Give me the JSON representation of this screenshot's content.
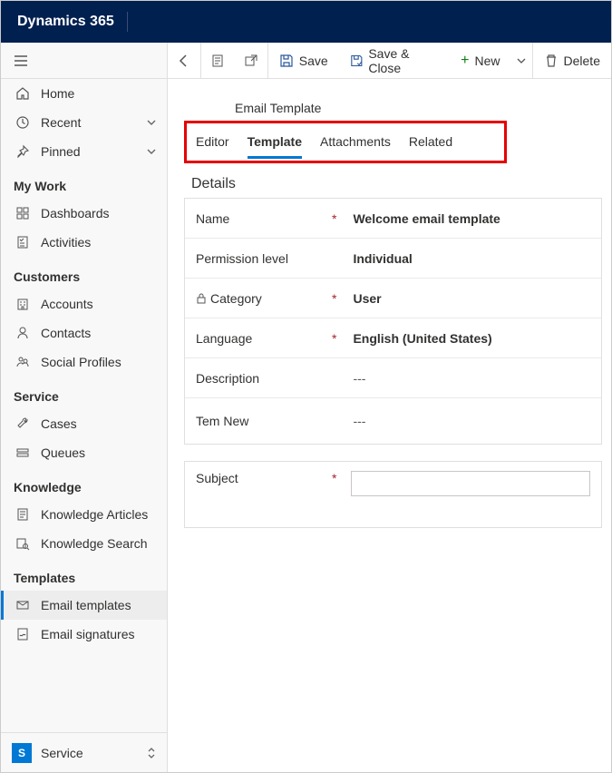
{
  "header": {
    "app_name": "Dynamics 365"
  },
  "sidebar": {
    "top": [
      {
        "icon": "home",
        "label": "Home"
      },
      {
        "icon": "clock",
        "label": "Recent",
        "expand": true
      },
      {
        "icon": "pin",
        "label": "Pinned",
        "expand": true
      }
    ],
    "sections": [
      {
        "title": "My Work",
        "items": [
          {
            "icon": "dashboard",
            "label": "Dashboards"
          },
          {
            "icon": "activities",
            "label": "Activities"
          }
        ]
      },
      {
        "title": "Customers",
        "items": [
          {
            "icon": "account",
            "label": "Accounts"
          },
          {
            "icon": "person",
            "label": "Contacts"
          },
          {
            "icon": "social",
            "label": "Social Profiles"
          }
        ]
      },
      {
        "title": "Service",
        "items": [
          {
            "icon": "wrench",
            "label": "Cases"
          },
          {
            "icon": "queue",
            "label": "Queues"
          }
        ]
      },
      {
        "title": "Knowledge",
        "items": [
          {
            "icon": "article",
            "label": "Knowledge Articles"
          },
          {
            "icon": "booksearch",
            "label": "Knowledge Search"
          }
        ]
      },
      {
        "title": "Templates",
        "items": [
          {
            "icon": "emailtpl",
            "label": "Email templates",
            "selected": true
          },
          {
            "icon": "sig",
            "label": "Email signatures"
          }
        ]
      }
    ],
    "area": {
      "badge": "S",
      "label": "Service"
    }
  },
  "cmdbar": {
    "back": "Back",
    "save": "Save",
    "save_close": "Save & Close",
    "new": "New",
    "delete": "Delete"
  },
  "page": {
    "entity_label": "Email Template",
    "tabs": [
      "Editor",
      "Template",
      "Attachments",
      "Related"
    ],
    "active_tab": "Template",
    "section_title": "Details",
    "fields": {
      "name": {
        "label": "Name",
        "required": true,
        "value": "Welcome email template"
      },
      "permission": {
        "label": "Permission level",
        "required": false,
        "value": "Individual"
      },
      "category": {
        "label": "Category",
        "required": true,
        "locked": true,
        "value": "User"
      },
      "language": {
        "label": "Language",
        "required": true,
        "value": "English (United States)"
      },
      "description": {
        "label": "Description",
        "required": false,
        "value": "---"
      },
      "temnew": {
        "label": "Tem New",
        "required": false,
        "value": "---"
      }
    },
    "subject": {
      "label": "Subject",
      "required": true,
      "value": ""
    }
  }
}
